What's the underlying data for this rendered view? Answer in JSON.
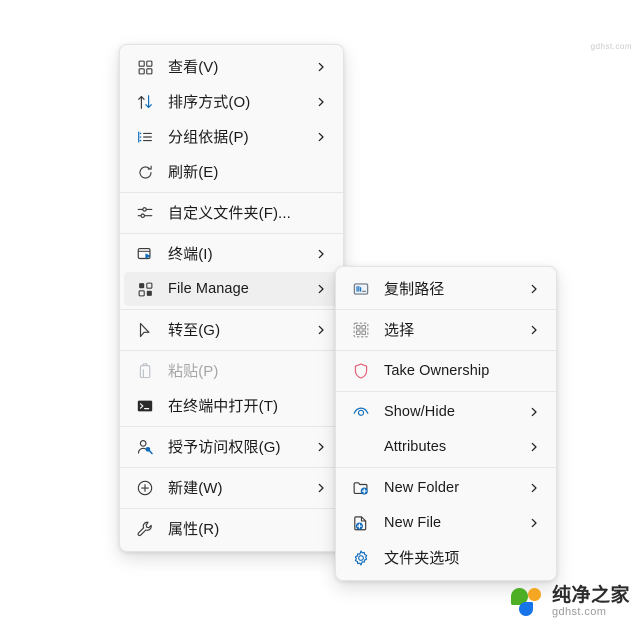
{
  "primary_menu": {
    "groups": [
      {
        "items": [
          {
            "label": "查看(V)",
            "icon": "grid-view-icon",
            "submenu": true,
            "disabled": false,
            "hovered": false,
            "lang": "cn"
          },
          {
            "label": "排序方式(O)",
            "icon": "sort-arrows-icon",
            "submenu": true,
            "disabled": false,
            "hovered": false,
            "lang": "cn"
          },
          {
            "label": "分组依据(P)",
            "icon": "group-list-icon",
            "submenu": true,
            "disabled": false,
            "hovered": false,
            "lang": "cn"
          },
          {
            "label": "刷新(E)",
            "icon": "refresh-icon",
            "submenu": false,
            "disabled": false,
            "hovered": false,
            "lang": "cn"
          }
        ]
      },
      {
        "items": [
          {
            "label": "自定义文件夹(F)...",
            "icon": "sliders-icon",
            "submenu": false,
            "disabled": false,
            "hovered": false,
            "lang": "cn"
          }
        ]
      },
      {
        "items": [
          {
            "label": "终端(I)",
            "icon": "terminal-window-icon",
            "submenu": true,
            "disabled": false,
            "hovered": false,
            "lang": "cn"
          },
          {
            "label": "File Manage",
            "icon": "grid-apps-icon",
            "submenu": true,
            "disabled": false,
            "hovered": true,
            "lang": "en"
          }
        ]
      },
      {
        "items": [
          {
            "label": "转至(G)",
            "icon": "cursor-arrow-icon",
            "submenu": true,
            "disabled": false,
            "hovered": false,
            "lang": "cn"
          }
        ]
      },
      {
        "items": [
          {
            "label": "粘贴(P)",
            "icon": "paste-clipboard-icon",
            "submenu": false,
            "disabled": true,
            "hovered": false,
            "lang": "cn"
          },
          {
            "label": "在终端中打开(T)",
            "icon": "terminal-console-icon",
            "submenu": false,
            "disabled": false,
            "hovered": false,
            "lang": "cn"
          }
        ]
      },
      {
        "items": [
          {
            "label": "授予访问权限(G)",
            "icon": "user-key-icon",
            "submenu": true,
            "disabled": false,
            "hovered": false,
            "lang": "cn"
          }
        ]
      },
      {
        "items": [
          {
            "label": "新建(W)",
            "icon": "plus-circle-icon",
            "submenu": true,
            "disabled": false,
            "hovered": false,
            "lang": "cn"
          }
        ]
      },
      {
        "items": [
          {
            "label": "属性(R)",
            "icon": "wrench-icon",
            "submenu": false,
            "disabled": false,
            "hovered": false,
            "lang": "cn"
          }
        ]
      }
    ]
  },
  "secondary_menu": {
    "groups": [
      {
        "items": [
          {
            "label": "复制路径",
            "icon": "copy-path-icon",
            "submenu": true,
            "disabled": false,
            "hovered": false,
            "lang": "cn"
          }
        ]
      },
      {
        "items": [
          {
            "label": "选择",
            "icon": "selection-dashed-icon",
            "submenu": true,
            "disabled": false,
            "hovered": false,
            "lang": "cn"
          }
        ]
      },
      {
        "items": [
          {
            "label": "Take Ownership",
            "icon": "shield-icon",
            "submenu": false,
            "disabled": false,
            "hovered": false,
            "lang": "en"
          }
        ]
      },
      {
        "items": [
          {
            "label": "Show/Hide",
            "icon": "eye-icon",
            "submenu": true,
            "disabled": false,
            "hovered": false,
            "lang": "en"
          },
          {
            "label": "Attributes",
            "icon": "none",
            "submenu": true,
            "disabled": false,
            "hovered": false,
            "lang": "en"
          }
        ]
      },
      {
        "items": [
          {
            "label": "New Folder",
            "icon": "new-folder-icon",
            "submenu": true,
            "disabled": false,
            "hovered": false,
            "lang": "en"
          },
          {
            "label": "New File",
            "icon": "new-file-icon",
            "submenu": true,
            "disabled": false,
            "hovered": false,
            "lang": "en"
          },
          {
            "label": "文件夹选项",
            "icon": "gear-icon",
            "submenu": false,
            "disabled": false,
            "hovered": false,
            "lang": "cn"
          }
        ]
      }
    ]
  },
  "watermark": {
    "corner_text": "gdhst.com",
    "brand_cn": "纯净之家",
    "brand_en": "gdhst.com",
    "colors": {
      "green": "#4caf26",
      "orange": "#f5a623",
      "blue": "#1773e8"
    }
  },
  "theme": {
    "menu_background": "#f9f9f9",
    "menu_border": "#e4e4e4",
    "hover_background": "#efefef",
    "text_color": "#1a1a1a",
    "disabled_text": "#a6a6a6",
    "accent_blue": "#0f6cbd",
    "shield_red": "#e3617a"
  }
}
